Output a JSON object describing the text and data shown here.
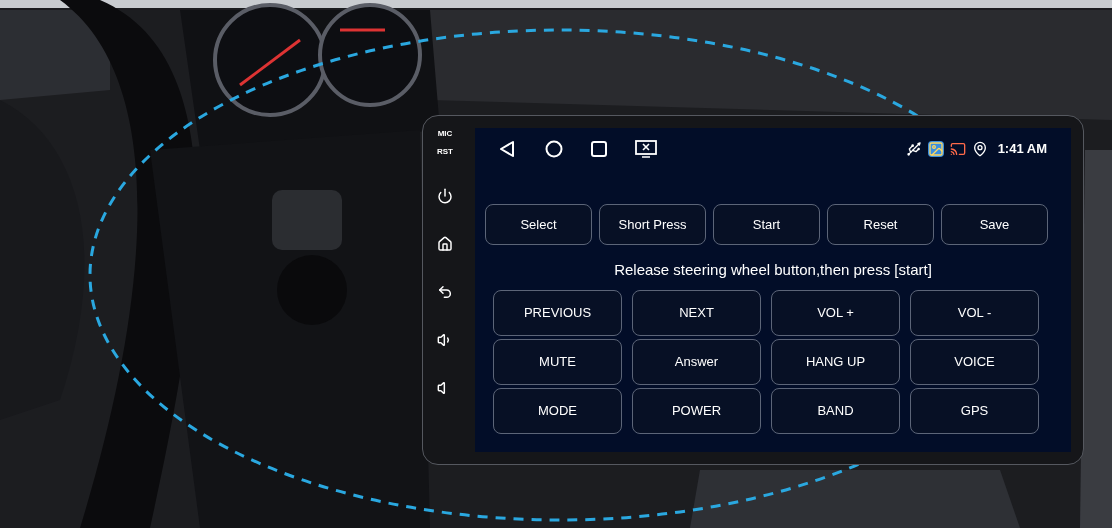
{
  "side_panel": {
    "labels": [
      "MIC",
      "RST"
    ]
  },
  "status_bar": {
    "time": "1:41 AM"
  },
  "actions": [
    {
      "label": "Select"
    },
    {
      "label": "Short Press"
    },
    {
      "label": "Start"
    },
    {
      "label": "Reset"
    },
    {
      "label": "Save"
    }
  ],
  "instruction": "Release steering wheel button,then press [start]",
  "keys": [
    {
      "label": "PREVIOUS"
    },
    {
      "label": "NEXT"
    },
    {
      "label": "VOL +"
    },
    {
      "label": "VOL -"
    },
    {
      "label": "MUTE"
    },
    {
      "label": "Answer"
    },
    {
      "label": "HANG UP"
    },
    {
      "label": "VOICE"
    },
    {
      "label": "MODE"
    },
    {
      "label": "POWER"
    },
    {
      "label": "BAND"
    },
    {
      "label": "GPS"
    }
  ]
}
